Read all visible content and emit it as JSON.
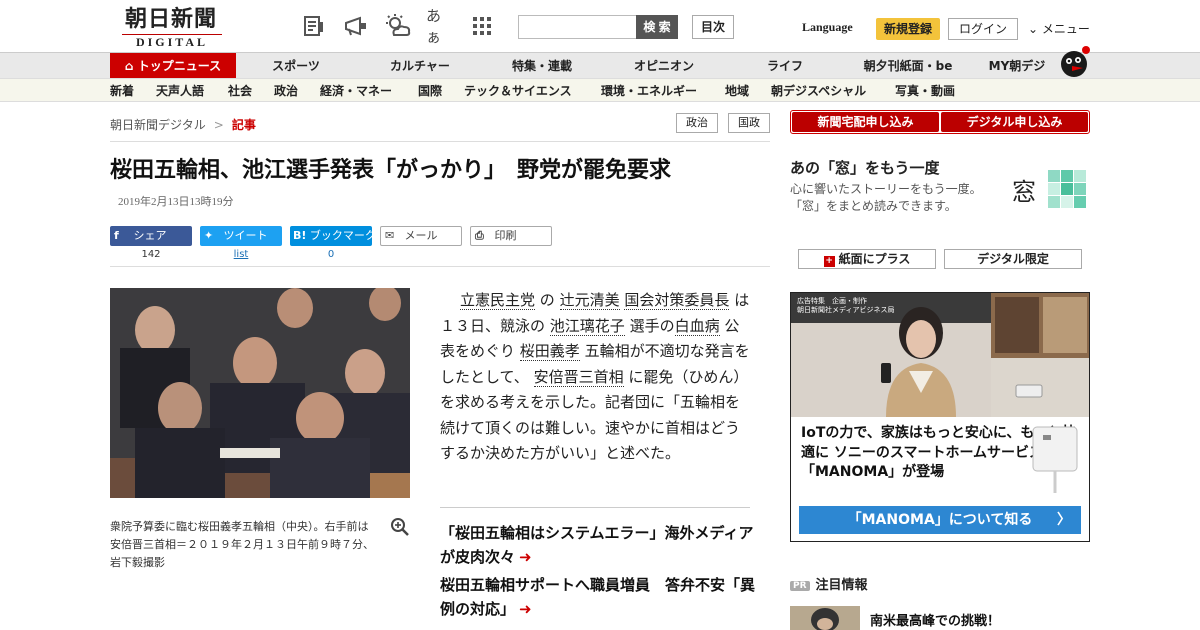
{
  "header": {
    "logo_jp": "朝日新聞",
    "logo_en": "DIGITAL",
    "icons": [
      "newspaper-icon",
      "megaphone-icon",
      "weather-icon",
      "font-size-icon",
      "grid-icon"
    ],
    "font_icon_text": "あぁ",
    "search_placeholder": "",
    "search_label": "検 索",
    "index_label": "目次",
    "language_label": "Language",
    "register_label": "新規登録",
    "login_label": "ログイン",
    "menu_label": "メニュー"
  },
  "nav_main": {
    "items": [
      "トップニュース",
      "スポーツ",
      "カルチャー",
      "特集・連載",
      "オピニオン",
      "ライフ",
      "朝夕刊紙面・be",
      "MY朝デジ"
    ]
  },
  "nav_sub": {
    "items": [
      "新着",
      "天声人語",
      "社会",
      "政治",
      "経済・マネー",
      "国際",
      "テック＆サイエンス",
      "環境・エネルギー",
      "地域",
      "朝デジスペシャル",
      "写真・動画"
    ]
  },
  "breadcrumb": {
    "root": "朝日新聞デジタル",
    "separator": ">",
    "current": "記事"
  },
  "tags": [
    "政治",
    "国政"
  ],
  "article": {
    "headline": "桜田五輪相、池江選手発表「がっかり」　野党が罷免要求",
    "date": "2019年2月13日13時19分",
    "share": {
      "facebook": {
        "label": "シェア",
        "count": "142"
      },
      "twitter": {
        "label": "ツイート",
        "count": "list"
      },
      "hatena": {
        "label": "ブックマーク",
        "count": "0"
      },
      "mail": {
        "label": "メール"
      },
      "print": {
        "label": "印刷"
      }
    },
    "caption": "衆院予算委に臨む桜田義孝五輪相（中央）。右手前は安倍晋三首相＝２０１９年２月１３日午前９時７分、岩下毅撮影",
    "body": {
      "p1": "立憲民主党",
      "p2": "の",
      "p3": "辻元清美",
      "p4": "国会対策委員長",
      "p5": "は１３日、競泳の",
      "p6": "池江璃花子",
      "p7": "選手の",
      "p8": "白血病",
      "p9": "公表をめぐり",
      "p10": "桜田義孝",
      "p11": "五輪相が不適切な発言をしたとして、",
      "p12": "安倍晋三首相",
      "p13": "に罷免（ひめん）を求める考えを示した。記者団に「五輪相を続けて頂くのは難しい。速やかに首相はどうするか決めた方がいい」と述べた。"
    },
    "related": [
      "「桜田五輪相はシステムエラー」海外メディアが皮肉次々",
      "桜田五輪相サポートへ職員増員　答弁不安「異例の対応」"
    ]
  },
  "sidebar": {
    "subscribe_paper": "新聞宅配申し込み",
    "subscribe_digital": "デジタル申し込み",
    "mado_title": "あの「窓」をもう一度",
    "mado_desc": "心に響いたストーリーをもう一度。「窓」をまとめ読みできます。",
    "mado_logo": "窓",
    "plus_label": "紙面にプラス",
    "digital_only_label": "デジタル限定",
    "ad": {
      "header_line1": "広告特集　企画・制作",
      "header_line2": "朝日新聞社メディアビジネス局",
      "text": "IoTの力で、家族はもっと安心に、もっと快適に ソニーのスマートホームサービス「MANOMA」が登場",
      "cta": "「MANOMA」について知る",
      "cta_chevron": "〉"
    },
    "pr_badge": "PR",
    "pr_title": "注目情報",
    "pr_item": "南米最高峰での挑戦！"
  },
  "colors": {
    "brand_red": "#cc0000",
    "register_yellow": "#f3c33b",
    "facebook": "#3b5998",
    "twitter": "#1da1f2",
    "hatena": "#008fde",
    "ad_cta": "#2d87d2"
  }
}
